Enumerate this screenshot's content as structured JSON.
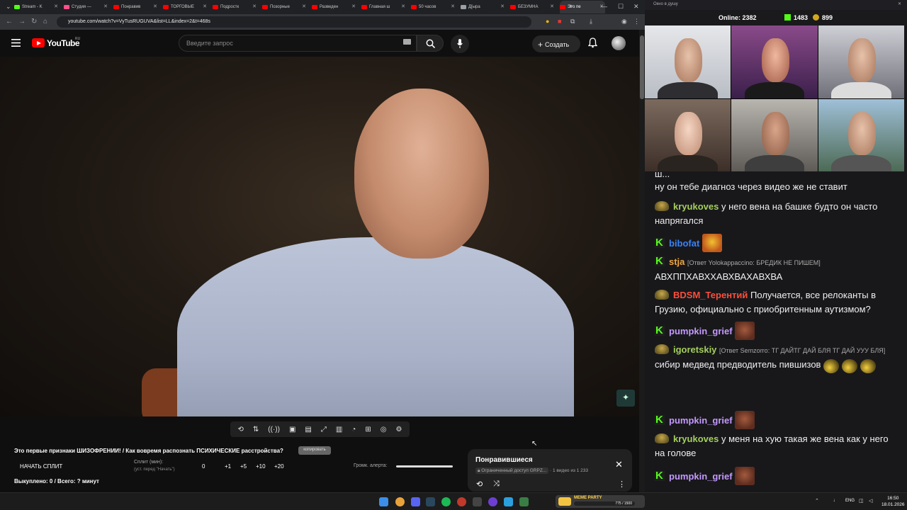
{
  "browser": {
    "tabs": [
      {
        "label": "Stream - K",
        "color": "#53fc18",
        "active": false
      },
      {
        "label": "Студия —",
        "color": "#ff4e8a",
        "active": false
      },
      {
        "label": "Понравив",
        "color": "#ff0000",
        "active": false
      },
      {
        "label": "ТОРГОВЫЕ",
        "color": "#ff0000",
        "active": false
      },
      {
        "label": "Подростк",
        "color": "#ff0000",
        "active": false
      },
      {
        "label": "Позорные",
        "color": "#ff0000",
        "active": false
      },
      {
        "label": "Разведен",
        "color": "#ff0000",
        "active": false
      },
      {
        "label": "Главная ш",
        "color": "#ff0000",
        "active": false
      },
      {
        "label": "50 часов",
        "color": "#ff0000",
        "active": false
      },
      {
        "label": "Д[ыра",
        "color": "#9aa0a6",
        "active": false
      },
      {
        "label": "БЕЗУМНА",
        "color": "#ff0000",
        "active": false
      },
      {
        "label": "Это пе",
        "color": "#ff0000",
        "active": true
      }
    ],
    "url": "youtube.com/watch?v=VyTusRUGUVA&list=LL&index=2&t=468s"
  },
  "youtube": {
    "logo_text": "YouTube",
    "region": "RU",
    "search_placeholder": "Введите запрос",
    "create_label": "Создать",
    "icons": [
      "menu-icon",
      "search-icon",
      "mic-icon",
      "plus-icon",
      "bell-icon"
    ]
  },
  "below_video": {
    "title": "Это первые признаки ШИЗОФРЕНИИ! / Как вовремя распознать ПСИХИЧЕСКИЕ расстройства?",
    "copy_label": "копировать",
    "split_button": "НАЧАТЬ СПЛИТ",
    "split_label": "Сплит (мин):",
    "split_hint": "(уст. перед \"Начать\")",
    "split_value": "0",
    "split_steps": [
      "+1",
      "+5",
      "+10",
      "+20"
    ],
    "alert_volume_label": "Громк. алерта:",
    "alert_volume": 1.0,
    "bought_text": "Выкуплено: 0 / Всего: ? минут"
  },
  "playlist": {
    "title": "Понравившиеся",
    "access": "Ограниченный доступ",
    "owner": "GRPZ...",
    "position": "1 видео из 1 233"
  },
  "overlay": {
    "window_title": "Окно в душу",
    "online_label": "Online:",
    "online_count": "2382",
    "kick_count": "1483",
    "coin_count": "899"
  },
  "chat": [
    {
      "badge": "none",
      "nick": "",
      "nick_color": "#efeff1",
      "reply": "",
      "text": "ш...",
      "emotes": []
    },
    {
      "badge": "none",
      "nick": "",
      "nick_color": "#efeff1",
      "reply": "",
      "text": "ну он тебе диагноз через видео же не ставит",
      "emotes": []
    },
    {
      "badge": "bear",
      "nick": "kryukoves",
      "nick_color": "#a4cf5b",
      "reply": "",
      "text": "у него вена на башке будто он часто напрягался",
      "emotes": []
    },
    {
      "badge": "k",
      "nick": "bibofat",
      "nick_color": "#3a82f7",
      "reply": "",
      "text": "",
      "emotes": [
        "dog"
      ]
    },
    {
      "badge": "k",
      "nick": "stja",
      "nick_color": "#f0a640",
      "reply": "[Ответ Yolokappaccino: БРЕДИК НЕ ПИШЕМ]",
      "text": "АВХППХАВХХАВХВАХАВХВА",
      "emotes": []
    },
    {
      "badge": "bear",
      "nick": "BDSM_Терентий",
      "nick_color": "#ff4e3a",
      "reply": "",
      "text": "Получается, все релоканты в Грузию, официально с приобритенным аутизмом?",
      "emotes": []
    },
    {
      "badge": "k",
      "nick": "pumpkin_grief",
      "nick_color": "#c59aff",
      "reply": "",
      "text": "",
      "emotes": [
        "face"
      ]
    },
    {
      "badge": "bear",
      "nick": "igoretskiy",
      "nick_color": "#a4cf5b",
      "reply": "[Ответ Semzorro: ТГ ДАЙТГ ДАЙ БЛЯ  ТГ ДАЙ УУУ БЛЯ]",
      "text": "сибир медвед предводитель пившизов",
      "emotes": [
        "duck",
        "duck",
        "duck"
      ]
    },
    {
      "badge": "k",
      "nick": "pumpkin_grief",
      "nick_color": "#c59aff",
      "reply": "",
      "text": "",
      "emotes": [
        "face"
      ]
    },
    {
      "badge": "bear",
      "nick": "kryukoves",
      "nick_color": "#a4cf5b",
      "reply": "",
      "text": "у меня на хую такая же вена как у него на голове",
      "emotes": []
    },
    {
      "badge": "k",
      "nick": "pumpkin_grief",
      "nick_color": "#c59aff",
      "reply": "",
      "text": "",
      "emotes": [
        "face"
      ]
    }
  ],
  "taskbar": {
    "widget_title": "MEME PARTY",
    "widget_value": "775 / 1500",
    "language": "ENG",
    "time": "16:50",
    "date": "18.01.2026"
  }
}
